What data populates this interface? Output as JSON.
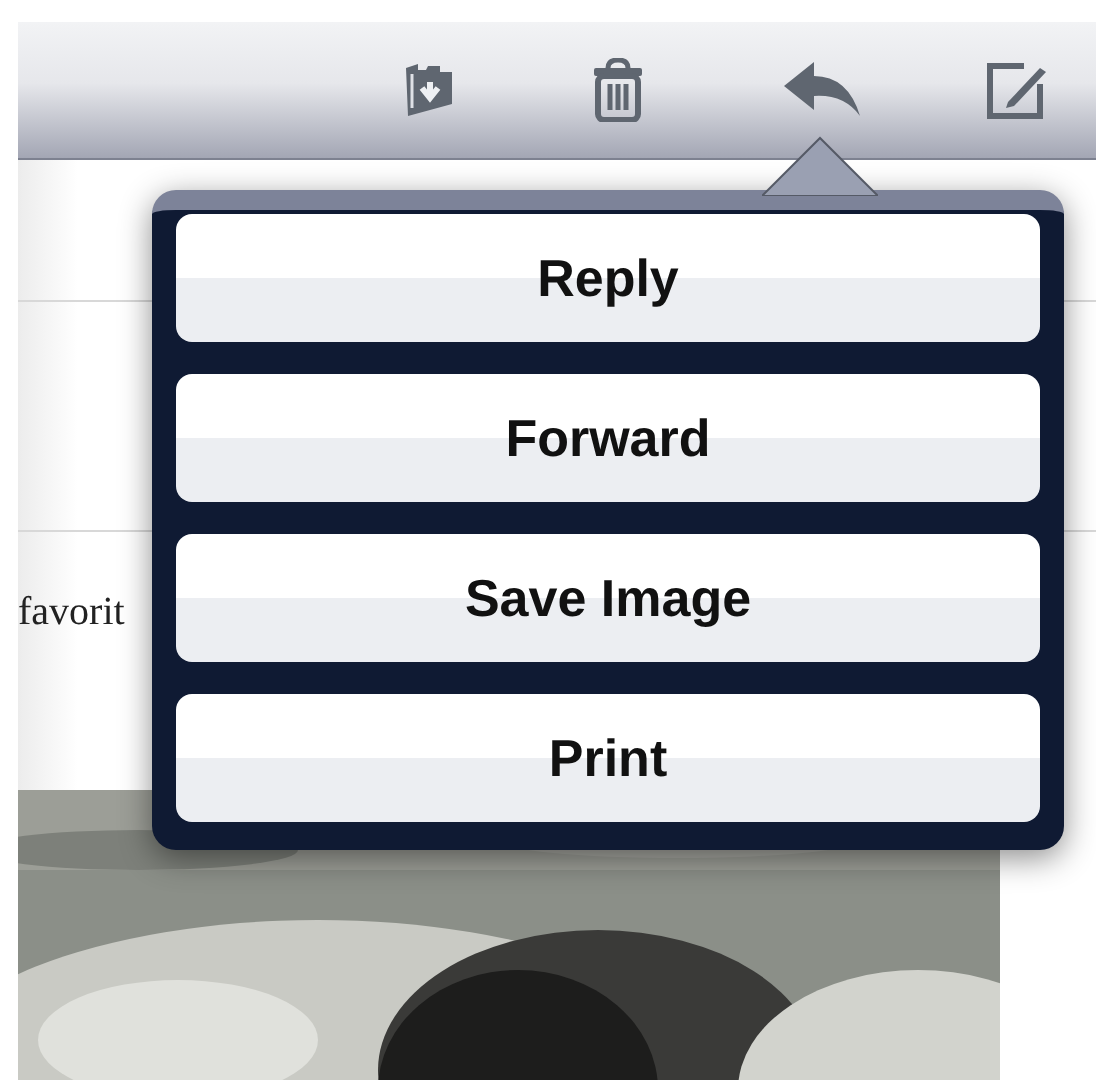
{
  "message": {
    "body_text": "favorit"
  },
  "action_menu": {
    "buttons": [
      {
        "label": "Reply"
      },
      {
        "label": "Forward"
      },
      {
        "label": "Save Image"
      },
      {
        "label": "Print"
      }
    ]
  }
}
